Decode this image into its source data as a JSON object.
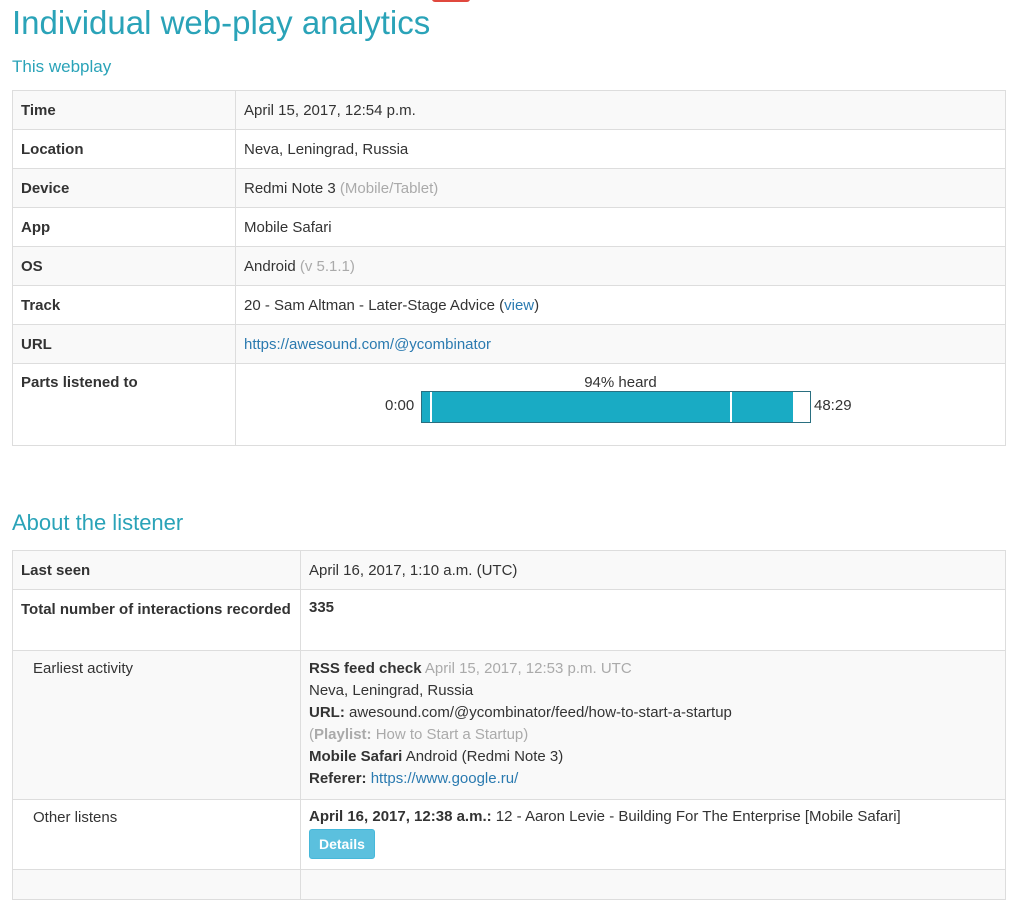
{
  "page": {
    "title": "Individual web-play analytics",
    "subtitle": "This webplay",
    "listener_heading": "About the listener"
  },
  "webplay": {
    "time_label": "Time",
    "time_value": "April 15, 2017, 12:54 p.m.",
    "location_label": "Location",
    "location_value": "Neva, Leningrad, Russia",
    "device_label": "Device",
    "device_value": "Redmi Note 3",
    "device_type": "(Mobile/Tablet)",
    "app_label": "App",
    "app_value": "Mobile Safari",
    "os_label": "OS",
    "os_value": "Android",
    "os_version": "(v 5.1.1)",
    "track_label": "Track",
    "track_value": "20 - Sam Altman - Later-Stage Advice (",
    "track_view": "view",
    "track_close": ")",
    "url_label": "URL",
    "url_value": "https://awesound.com/@ycombinator",
    "parts_label": "Parts listened to",
    "heard_text": "94% heard",
    "start_time": "0:00",
    "end_time": "48:29",
    "heard_fraction_end": 0.955,
    "segment_marks": [
      0.02,
      0.795
    ]
  },
  "listener": {
    "last_seen_label": "Last seen",
    "last_seen_value": "April 16, 2017, 1:10 a.m. (UTC)",
    "interactions_label": "Total number of interactions recorded",
    "interactions_value": "335",
    "earliest_label": "Earliest activity",
    "earliest": {
      "event": "RSS feed check",
      "event_time": "April 15, 2017, 12:53 p.m. UTC",
      "location": "Neva, Leningrad, Russia",
      "url_label": "URL:",
      "url_value": "awesound.com/@ycombinator/feed/how-to-start-a-startup",
      "playlist_open": "(",
      "playlist_label": "Playlist:",
      "playlist_value": "How to Start a Startup)",
      "app": "Mobile Safari",
      "app_rest": "Android (Redmi Note 3)",
      "referer_label": "Referer:",
      "referer_value": "https://www.google.ru/"
    },
    "other_label": "Other listens",
    "other": {
      "date": "April 16, 2017, 12:38 a.m.:",
      "desc": "12 - Aaron Levie - Building For The Enterprise [Mobile Safari]",
      "button": "Details"
    }
  }
}
